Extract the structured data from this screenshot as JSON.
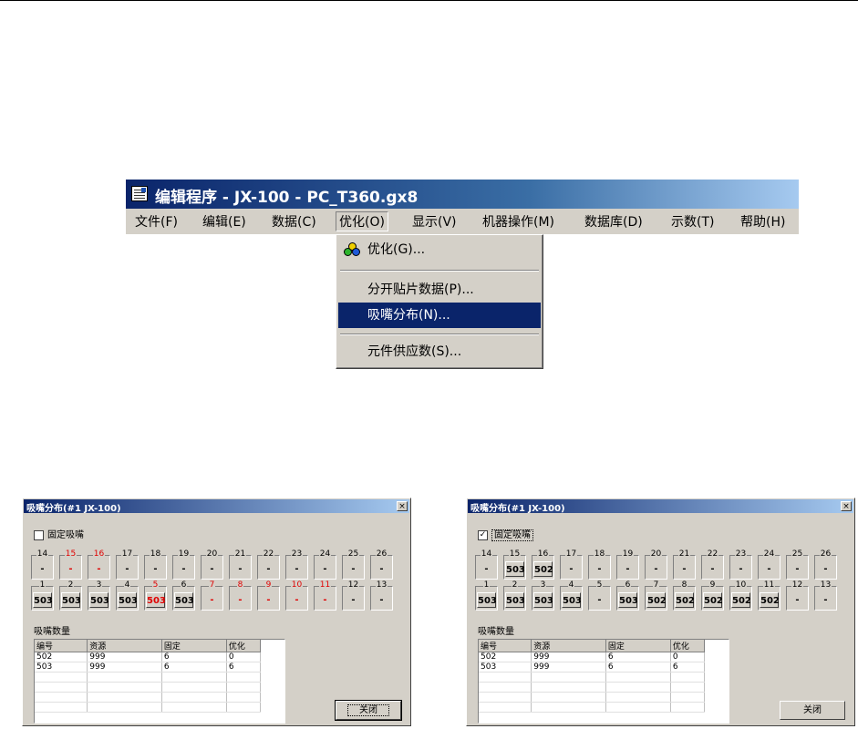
{
  "app": {
    "title": "编辑程序 - JX-100 - PC_T360.gx8",
    "menu": [
      "文件(F)",
      "编辑(E)",
      "数据(C)",
      "优化(O)",
      "显示(V)",
      "机器操作(M)",
      "数据库(D)",
      "示数(T)",
      "帮助(H)"
    ],
    "active_menu": "优化(O)",
    "dropdown": {
      "optimize": "优化(G)...",
      "split_placement": "分开贴片数据(P)...",
      "nozzle_distribution": "吸嘴分布(N)...",
      "component_supply": "元件供应数(S)..."
    }
  },
  "colors": {
    "titlebar_start": "#0a246a",
    "highlight": "#0a246a",
    "red_value": "#e00000",
    "face": "#d4d0c8"
  },
  "dialogs": [
    {
      "title": "吸嘴分布(#1 JX-100)",
      "close_icon": "×",
      "fixed_checkbox": {
        "label": "固定吸嘴",
        "checked": false,
        "check_glyph": ""
      },
      "top_row": [
        {
          "n": "14",
          "v": "-",
          "red": false
        },
        {
          "n": "15",
          "v": "-",
          "red": true
        },
        {
          "n": "16",
          "v": "-",
          "red": true
        },
        {
          "n": "17",
          "v": "-",
          "red": false
        },
        {
          "n": "18",
          "v": "-",
          "red": false
        },
        {
          "n": "19",
          "v": "-",
          "red": false
        },
        {
          "n": "20",
          "v": "-",
          "red": false
        },
        {
          "n": "21",
          "v": "-",
          "red": false
        },
        {
          "n": "22",
          "v": "-",
          "red": false
        },
        {
          "n": "23",
          "v": "-",
          "red": false
        },
        {
          "n": "24",
          "v": "-",
          "red": false
        },
        {
          "n": "25",
          "v": "-",
          "red": false
        },
        {
          "n": "26",
          "v": "-",
          "red": false
        }
      ],
      "bottom_row": [
        {
          "n": "1",
          "v": "503",
          "red": false,
          "numred": false
        },
        {
          "n": "2",
          "v": "503",
          "red": false,
          "numred": false
        },
        {
          "n": "3",
          "v": "503",
          "red": false,
          "numred": false
        },
        {
          "n": "4",
          "v": "503",
          "red": false,
          "numred": false
        },
        {
          "n": "5",
          "v": "503",
          "red": true,
          "numred": true
        },
        {
          "n": "6",
          "v": "503",
          "red": false,
          "numred": false
        },
        {
          "n": "7",
          "v": "-",
          "red": true,
          "numred": true
        },
        {
          "n": "8",
          "v": "-",
          "red": true,
          "numred": true
        },
        {
          "n": "9",
          "v": "-",
          "red": true,
          "numred": true
        },
        {
          "n": "10",
          "v": "-",
          "red": true,
          "numred": true
        },
        {
          "n": "11",
          "v": "-",
          "red": true,
          "numred": true
        },
        {
          "n": "12",
          "v": "-",
          "red": false,
          "numred": false
        },
        {
          "n": "13",
          "v": "-",
          "red": false,
          "numred": false
        }
      ],
      "count_label": "吸嘴数量",
      "table": {
        "headers": [
          "编号",
          "资源",
          "固定",
          "优化"
        ],
        "rows": [
          [
            "502",
            "999",
            "6",
            "0"
          ],
          [
            "503",
            "999",
            "6",
            "6"
          ],
          [
            "",
            "",
            "",
            ""
          ],
          [
            "",
            "",
            "",
            ""
          ],
          [
            "",
            "",
            "",
            ""
          ],
          [
            "",
            "",
            "",
            ""
          ]
        ]
      },
      "close_button": "关闭"
    },
    {
      "title": "吸嘴分布(#1 JX-100)",
      "close_icon": "×",
      "fixed_checkbox": {
        "label": "固定吸嘴",
        "checked": true,
        "check_glyph": "✓"
      },
      "top_row": [
        {
          "n": "14",
          "v": "-",
          "red": false
        },
        {
          "n": "15",
          "v": "503",
          "red": false
        },
        {
          "n": "16",
          "v": "502",
          "red": false
        },
        {
          "n": "17",
          "v": "-",
          "red": false
        },
        {
          "n": "18",
          "v": "-",
          "red": false
        },
        {
          "n": "19",
          "v": "-",
          "red": false
        },
        {
          "n": "20",
          "v": "-",
          "red": false
        },
        {
          "n": "21",
          "v": "-",
          "red": false
        },
        {
          "n": "22",
          "v": "-",
          "red": false
        },
        {
          "n": "23",
          "v": "-",
          "red": false
        },
        {
          "n": "24",
          "v": "-",
          "red": false
        },
        {
          "n": "25",
          "v": "-",
          "red": false
        },
        {
          "n": "26",
          "v": "-",
          "red": false
        }
      ],
      "bottom_row": [
        {
          "n": "1",
          "v": "503",
          "red": false,
          "numred": false
        },
        {
          "n": "2",
          "v": "503",
          "red": false,
          "numred": false
        },
        {
          "n": "3",
          "v": "503",
          "red": false,
          "numred": false
        },
        {
          "n": "4",
          "v": "503",
          "red": false,
          "numred": false
        },
        {
          "n": "5",
          "v": "-",
          "red": false,
          "numred": false
        },
        {
          "n": "6",
          "v": "503",
          "red": false,
          "numred": false
        },
        {
          "n": "7",
          "v": "502",
          "red": false,
          "numred": false
        },
        {
          "n": "8",
          "v": "502",
          "red": false,
          "numred": false
        },
        {
          "n": "9",
          "v": "502",
          "red": false,
          "numred": false
        },
        {
          "n": "10",
          "v": "502",
          "red": false,
          "numred": false
        },
        {
          "n": "11",
          "v": "502",
          "red": false,
          "numred": false
        },
        {
          "n": "12",
          "v": "-",
          "red": false,
          "numred": false
        },
        {
          "n": "13",
          "v": "-",
          "red": false,
          "numred": false
        }
      ],
      "count_label": "吸嘴数量",
      "table": {
        "headers": [
          "编号",
          "资源",
          "固定",
          "优化"
        ],
        "rows": [
          [
            "502",
            "999",
            "6",
            "0"
          ],
          [
            "503",
            "999",
            "6",
            "6"
          ],
          [
            "",
            "",
            "",
            ""
          ],
          [
            "",
            "",
            "",
            ""
          ],
          [
            "",
            "",
            "",
            ""
          ],
          [
            "",
            "",
            "",
            ""
          ]
        ]
      },
      "close_button": "关闭"
    }
  ]
}
